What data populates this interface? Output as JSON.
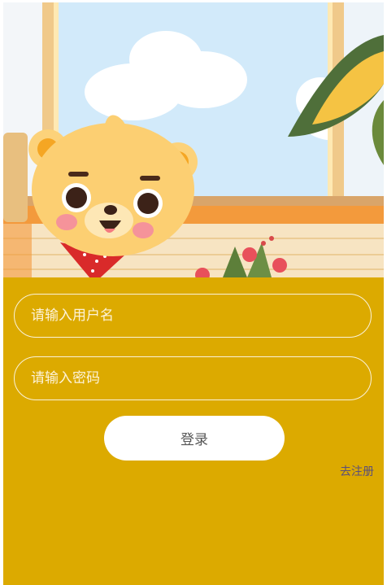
{
  "colors": {
    "form_background": "#dcaa00",
    "button_background": "#ffffff",
    "link_color": "#5a4f7a"
  },
  "hero": {
    "illustration": "cartoon-bear-at-window"
  },
  "form": {
    "username_placeholder": "请输入用户名",
    "username_value": "",
    "password_placeholder": "请输入密码",
    "password_value": "",
    "login_label": "登录",
    "register_link": "去注册"
  }
}
